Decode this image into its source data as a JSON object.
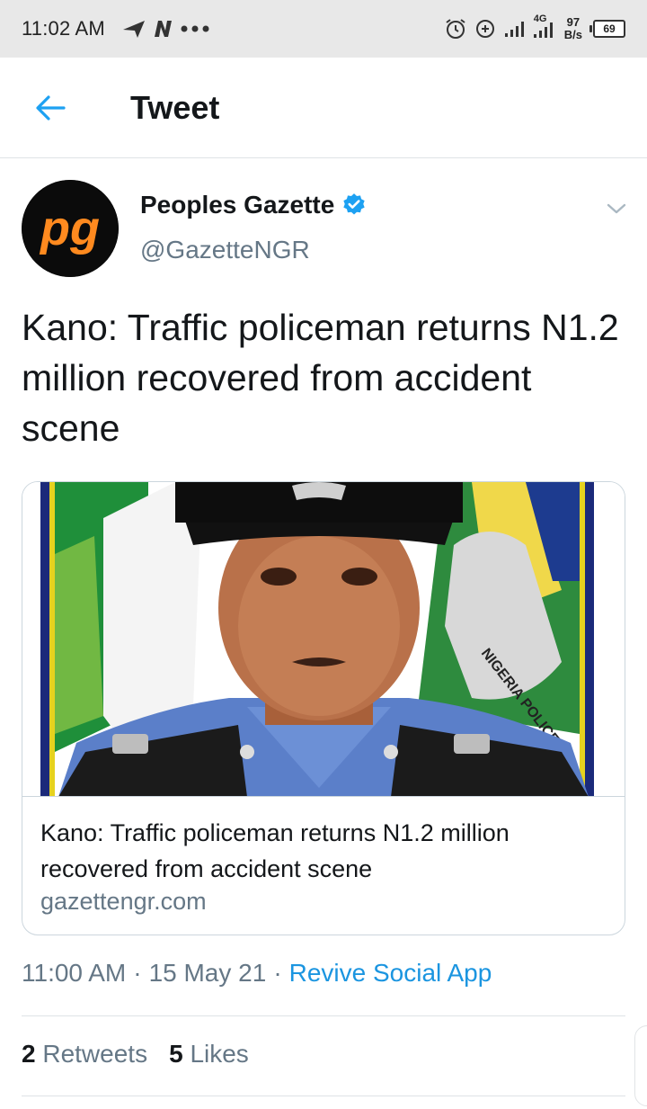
{
  "status_bar": {
    "time": "11:02 AM",
    "net_speed_value": "97",
    "net_speed_unit": "B/s",
    "battery": "69",
    "network_type": "4G"
  },
  "header": {
    "title": "Tweet"
  },
  "tweet": {
    "author_name": "Peoples Gazette",
    "author_handle": "@GazetteNGR",
    "avatar_text": "pg",
    "text": "Kano: Traffic policeman returns N1.2 million recovered from accident scene",
    "card": {
      "title": "Kano: Traffic policeman returns N1.2 million recovered from accident scene",
      "domain": "gazettengr.com",
      "flag_text": "NIGERIA POLICE"
    },
    "time": "11:00 AM",
    "date": "15 May 21",
    "source": "Revive Social App",
    "separator": "·",
    "retweets_count": "2",
    "retweets_label": "Retweets",
    "likes_count": "5",
    "likes_label": "Likes"
  },
  "colors": {
    "accent": "#1b95e0",
    "secondary_text": "#657786",
    "primary_text": "#14171a",
    "verified": "#1da1f2"
  }
}
